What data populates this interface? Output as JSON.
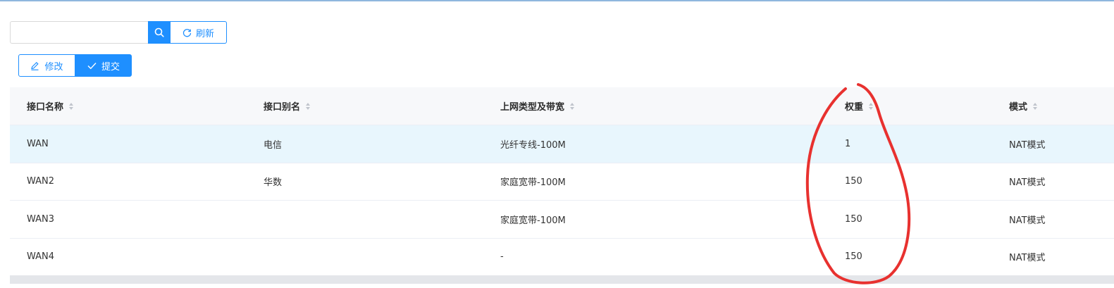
{
  "search": {
    "value": "",
    "placeholder": ""
  },
  "toolbar": {
    "refresh_label": "刷新",
    "edit_label": "修改",
    "submit_label": "提交"
  },
  "table": {
    "columns": [
      "接口名称",
      "接口别名",
      "上网类型及带宽",
      "权重",
      "模式"
    ],
    "rows": [
      {
        "name": "WAN",
        "alias": "电信",
        "type": "光纤专线-100M",
        "weight": "1",
        "mode": "NAT模式"
      },
      {
        "name": "WAN2",
        "alias": "华数",
        "type": "家庭宽带-100M",
        "weight": "150",
        "mode": "NAT模式"
      },
      {
        "name": "WAN3",
        "alias": "",
        "type": "家庭宽带-100M",
        "weight": "150",
        "mode": "NAT模式"
      },
      {
        "name": "WAN4",
        "alias": "",
        "type": "-",
        "weight": "150",
        "mode": "NAT模式"
      }
    ]
  },
  "colors": {
    "accent": "#1e8fff",
    "highlight_row": "#e8f6fd",
    "annotation": "#e8312f"
  },
  "icons": [
    "search-icon",
    "refresh-icon",
    "edit-icon",
    "check-icon",
    "sort-icon"
  ]
}
